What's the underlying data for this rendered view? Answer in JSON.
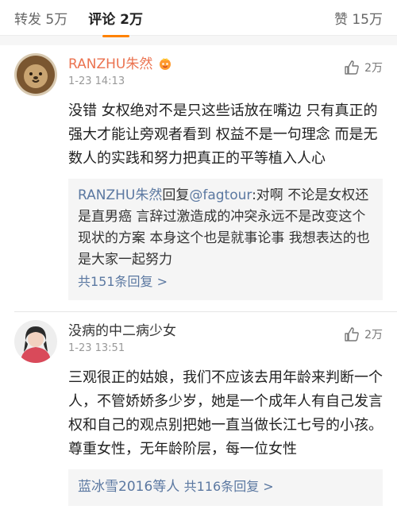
{
  "tabs": {
    "repost": "转发 5万",
    "comment": "评论 2万",
    "like": "赞 15万"
  },
  "comments": [
    {
      "author": "RANZHU朱然",
      "time": "1-23 14:13",
      "likes": "2万",
      "text": "没错 女权绝对不是只这些话放在嘴边 只有真正的强大才能让旁观者看到 权益不是一句理念 而是无数人的实践和努力把真正的平等植入人心",
      "reply": {
        "author": "RANZHU朱然",
        "verb": "回复",
        "mention": "@fagtour",
        "text": ":对啊 不论是女权还是直男癌 言辞过激造成的冲突永远不是改变这个现状的方案 本身这个也是就事论事 我想表达的也是大家一起努力",
        "more": "共151条回复 >"
      }
    },
    {
      "author": "没病的中二病少女",
      "time": "1-23 13:51",
      "likes": "2万",
      "text": "三观很正的姑娘，我们不应该去用年龄来判断一个人，不管娇娇多少岁，她是一个成年人有自己发言权和自己的观点别把她一直当做长江七号的小孩。尊重女性，无年龄阶层，每一位女性",
      "reply": {
        "users": "蓝冰雪2016等人",
        "more": "共116条回复 >"
      }
    }
  ],
  "colors": {
    "accent": "#ff8200",
    "vip_name": "#eb7350",
    "link": "#5b78a1"
  }
}
